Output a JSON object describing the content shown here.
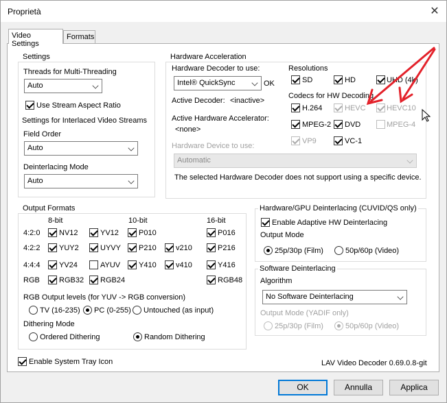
{
  "window": {
    "title": "Proprietà"
  },
  "tabs": [
    "Video Settings",
    "Formats"
  ],
  "settings": {
    "title": "Settings",
    "threads_label": "Threads for Multi-Threading",
    "threads_value": "Auto",
    "stream_aspect": "Use Stream Aspect Ratio",
    "interlaced_label": "Settings for Interlaced Video Streams",
    "field_order_label": "Field Order",
    "field_order_value": "Auto",
    "deint_mode_label": "Deinterlacing Mode",
    "deint_mode_value": "Auto"
  },
  "hwaccel": {
    "title": "Hardware Acceleration",
    "decoder_label": "Hardware Decoder to use:",
    "decoder_value": "Intel® QuickSync",
    "ok_text": "OK",
    "active_decoder_label": "Active Decoder:",
    "active_decoder_value": "<inactive>",
    "active_accel_label": "Active Hardware Accelerator:",
    "active_accel_value": "<none>",
    "device_label": "Hardware Device to use:",
    "device_value": "Automatic",
    "note": "The selected Hardware Decoder does not support using a specific device.",
    "resolutions_label": "Resolutions",
    "res": {
      "sd": "SD",
      "hd": "HD",
      "uhd": "UHD (4k)"
    },
    "codecs_label": "Codecs for HW Decoding",
    "codecs": {
      "h264": "H.264",
      "hevc": "HEVC",
      "hevc10": "HEVC10",
      "mpeg2": "MPEG-2",
      "dvd": "DVD",
      "mpeg4": "MPEG-4",
      "vp9": "VP9",
      "vc1": "VC-1"
    }
  },
  "output": {
    "title": "Output Formats",
    "col_8bit": "8-bit",
    "col_10bit": "10-bit",
    "col_16bit": "16-bit",
    "row_420": "4:2:0",
    "row_422": "4:2:2",
    "row_444": "4:4:4",
    "row_rgb": "RGB",
    "nv12": "NV12",
    "yv12": "YV12",
    "p010": "P010",
    "p016": "P016",
    "yuy2": "YUY2",
    "uyvy": "UYVY",
    "p210": "P210",
    "v210": "v210",
    "p216": "P216",
    "yv24": "YV24",
    "ayuv": "AYUV",
    "y410": "Y410",
    "v410": "v410",
    "y416": "Y416",
    "rgb32": "RGB32",
    "rgb24": "RGB24",
    "rgb48": "RGB48",
    "levels_label": "RGB Output levels (for YUV -> RGB conversion)",
    "levels_tv": "TV (16-235)",
    "levels_pc": "PC (0-255)",
    "levels_untouched": "Untouched (as input)",
    "dither_label": "Dithering Mode",
    "dither_ordered": "Ordered Dithering",
    "dither_random": "Random Dithering"
  },
  "hwdeint": {
    "title": "Hardware/GPU Deinterlacing (CUVID/QS only)",
    "enable": "Enable Adaptive HW Deinterlacing",
    "output_mode_label": "Output Mode",
    "film": "25p/30p (Film)",
    "video": "50p/60p (Video)"
  },
  "swdeint": {
    "title": "Software Deinterlacing",
    "algorithm_label": "Algorithm",
    "algorithm_value": "No Software Deinterlacing",
    "output_mode_label": "Output Mode (YADIF only)",
    "film": "25p/30p (Film)",
    "video": "50p/60p (Video)"
  },
  "footer": {
    "tray": "Enable System Tray Icon",
    "version": "LAV Video Decoder 0.69.0.8-git"
  },
  "buttons": {
    "ok": "OK",
    "cancel": "Annulla",
    "apply": "Applica"
  },
  "colors": {
    "annotation_arrow": "#e3212a",
    "default_button_border": "#0078d7"
  }
}
